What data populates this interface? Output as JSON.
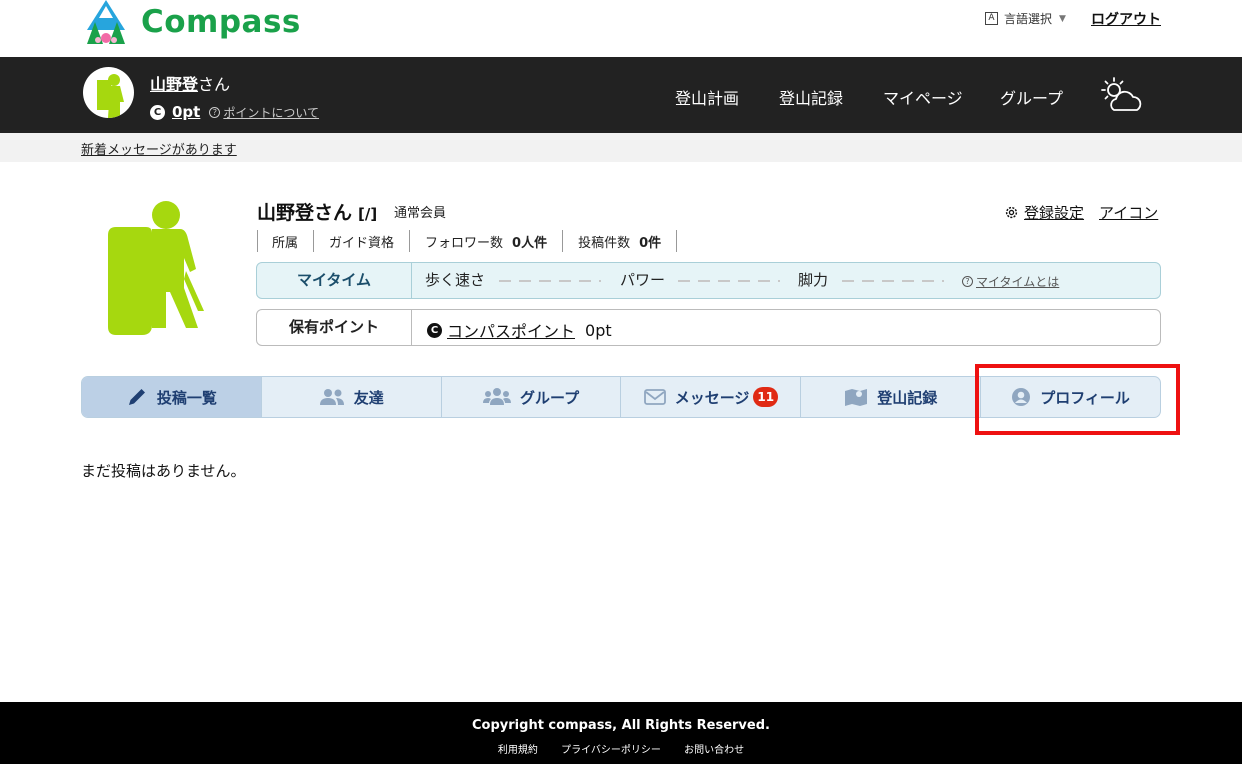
{
  "brand": {
    "name": "Compass",
    "color": "#1aa14a"
  },
  "header": {
    "language_label": "言語選択",
    "logout_label": "ログアウト"
  },
  "navbar": {
    "username": "山野登",
    "honorific": "さん",
    "points": "0pt",
    "points_help": "ポイントについて",
    "menu": [
      "登山計画",
      "登山記録",
      "マイページ",
      "グループ"
    ],
    "weather_icon": "weather-icon"
  },
  "notice": {
    "text": "新着メッセージがあります"
  },
  "profile": {
    "name": "山野登さん",
    "slash": "[/]",
    "member_type": "通常会員",
    "settings_label": "登録設定",
    "icon_label": "アイコン",
    "stats": [
      {
        "label": "所属",
        "value": ""
      },
      {
        "label": "ガイド資格",
        "value": ""
      },
      {
        "label": "フォロワー数",
        "value": "0人件"
      },
      {
        "label": "投稿件数",
        "value": "0件"
      }
    ],
    "mytime": {
      "label": "マイタイム",
      "items": [
        "歩く速さ",
        "パワー",
        "脚力"
      ],
      "help": "マイタイムとは"
    },
    "points_box": {
      "label": "保有ポイント",
      "link": "コンパスポイント",
      "value": "0pt"
    }
  },
  "tabs": [
    {
      "label": "投稿一覧",
      "icon": "pencil-icon"
    },
    {
      "label": "友達",
      "icon": "users-icon"
    },
    {
      "label": "グループ",
      "icon": "group-icon"
    },
    {
      "label": "メッセージ",
      "icon": "envelope-icon",
      "badge": "11"
    },
    {
      "label": "登山記録",
      "icon": "map-icon"
    },
    {
      "label": "プロフィール",
      "icon": "user-circle-icon"
    }
  ],
  "content": {
    "empty_text": "まだ投稿はありません。"
  },
  "footer": {
    "copyright": "Copyright compass, All Rights Reserved.",
    "links": [
      "利用規約",
      "プライバシーポリシー",
      "お問い合わせ"
    ]
  },
  "colors": {
    "highlight": "#ee1111",
    "badge": "#e02a14",
    "navbar": "#222222",
    "avatar_green": "#a6d80f"
  }
}
